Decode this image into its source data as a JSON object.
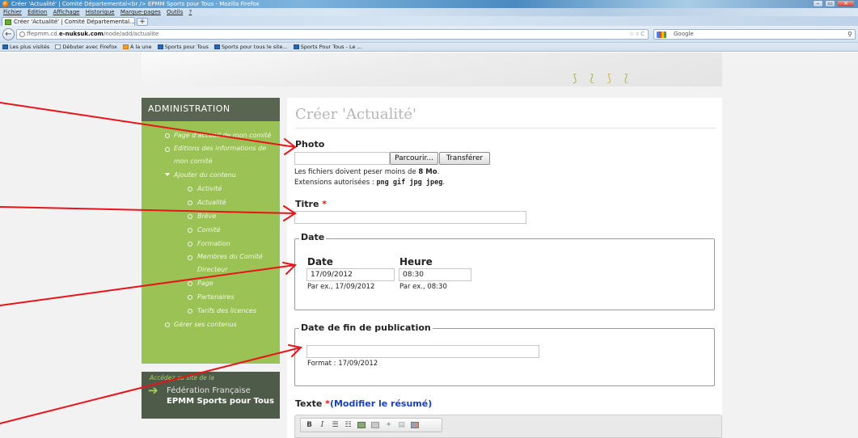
{
  "browser": {
    "window_title": "Créer 'Actualité' | Comité Départemental<br /> EPMM Sports pour Tous - Mozilla Firefox",
    "menu": [
      "Fichier",
      "Édition",
      "Affichage",
      "Historique",
      "Marque-pages",
      "Outils",
      "?"
    ],
    "tab_title": "Créer 'Actualité' | Comité Départemental...",
    "new_tab": "+",
    "url_prefix": "ffepmm.cd.",
    "url_domain": "e-nuksuk.com",
    "url_path": "/node/add/actualite",
    "url_right": "☆ ▿ C",
    "search_placeholder": "Google",
    "bookmarks": [
      "Les plus visités",
      "Débuter avec Firefox",
      "À la une",
      "Sports pour Tous",
      "Sports pour tous le site...",
      "Sports Pour Tous - Le ..."
    ]
  },
  "sidebar": {
    "heading": "ADMINISTRATION",
    "items": [
      {
        "label": "Page d'accueil de mon comité"
      },
      {
        "label": "Editions des informations de mon comité"
      },
      {
        "label": "Ajouter du contenu"
      },
      {
        "label": "Activité"
      },
      {
        "label": "Actualité"
      },
      {
        "label": "Brève"
      },
      {
        "label": "Comité"
      },
      {
        "label": "Formation"
      },
      {
        "label": "Membres du Comité Directeur"
      },
      {
        "label": "Page"
      },
      {
        "label": "Partenaires"
      },
      {
        "label": "Tarifs des licences"
      },
      {
        "label": "Gérer ses contenus"
      }
    ],
    "federation": {
      "small": "Accédez au site de la",
      "line1": "Fédération Française",
      "line2": "EPMM Sports pour Tous"
    }
  },
  "form": {
    "title": "Créer 'Actualité'",
    "photo": {
      "label": "Photo",
      "browse_button": "Parcourir...",
      "upload_button": "Transférer",
      "size_text_before": "Les fichiers doivent peser moins de ",
      "size_value": "8 Mo",
      "size_text_after": ".",
      "ext_text": "Extensions autorisées : ",
      "ext_values": "png gif jpg jpeg",
      "ext_after": "."
    },
    "titre": {
      "label": "Titre",
      "required": "*",
      "value": ""
    },
    "date_group": {
      "legend": "Date",
      "date_label": "Date",
      "date_value": "17/09/2012",
      "date_hint": "Par ex., 17/09/2012",
      "time_label": "Heure",
      "time_value": "08:30",
      "time_hint": "Par ex., 08:30"
    },
    "end_date_group": {
      "legend": "Date de fin de publication",
      "value": "",
      "hint": "Format : 17/09/2012"
    },
    "texte": {
      "label": "Texte",
      "required": "*",
      "link": "(Modifier le résumé)"
    },
    "toolbar_icons": [
      "bold-icon",
      "italic-icon",
      "bullet-list-icon",
      "numbered-list-icon",
      "image-icon",
      "image-alt-icon",
      "flash-icon",
      "paste-icon",
      "picture-icon"
    ]
  },
  "colors": {
    "sidebar_green": "#9bc255",
    "sidebar_dark": "#5a6551",
    "annotation_red": "#e8141a",
    "link_blue": "#1a3fbf"
  }
}
